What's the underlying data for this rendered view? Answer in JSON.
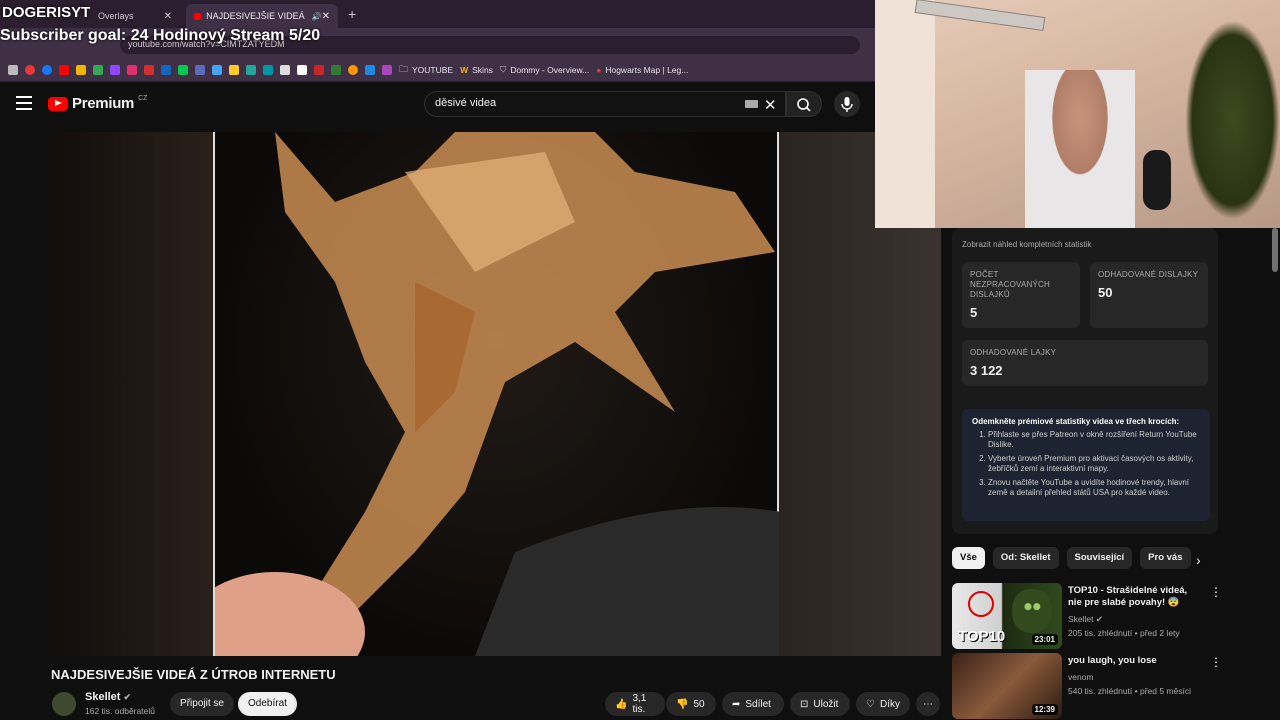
{
  "browser": {
    "tabs": [
      {
        "label": "Overlays"
      },
      {
        "label": "NAJDESIVEJŠIE VIDEÁ Z ÚTROB"
      }
    ],
    "url": "youtube.com/watch?v=CIMTZATYEDM",
    "bookmarks": [
      "YOUTUBE",
      "Skins",
      "Dommy - Overview...",
      "Hogwarts Map | Leg..."
    ]
  },
  "overlay": {
    "title": "DOGERISYT",
    "subtitle": "Subscriber goal: 24 Hodinový Stream 5/20"
  },
  "youtube": {
    "logo_text": "Premium",
    "logo_region": "CZ",
    "search_value": "děsivé videa"
  },
  "video": {
    "title": "NAJDESIVEJŠIE VIDEÁ Z ÚTROB INTERNETU",
    "channel": "Skellet",
    "subscribers": "162 tis. odběratelů",
    "join_label": "Připojit se",
    "subscribe_label": "Odebírat",
    "likes": "3,1 tis.",
    "dislikes": "50",
    "share_label": "Sdílet",
    "save_label": "Uložit",
    "thanks_label": "Díky"
  },
  "stats_panel": {
    "preview_link": "Zobrazit náhled kompletních statistik",
    "cards": [
      {
        "label": "POČET NEZPRACOVANÝCH DISLAJKŮ",
        "value": "5"
      },
      {
        "label": "ODHADOVANÉ DISLAJKY",
        "value": "50"
      },
      {
        "label": "ODHADOVANÉ LAJKY",
        "value": "3 122"
      }
    ],
    "premium_heading": "Odemkněte prémiové statistiky videa ve třech krocích:",
    "steps": [
      "Přihlaste se přes Patreon v okně rozšíření Return YouTube Dislike.",
      "Vyberte úroveň Premium pro aktivaci časových os aktivity, žebříčků zemí a interaktivní mapy.",
      "Znovu načtěte YouTube a uvidíte hodinové trendy, hlavní země a detailní přehled států USA pro každé video."
    ]
  },
  "chips": [
    "Vše",
    "Od: Skellet",
    "Související",
    "Pro vás"
  ],
  "recommendations": [
    {
      "title": "TOP10 - Strašidelné videá, nie pre slabé povahy! 😨",
      "channel": "Skellet",
      "meta": "205 tis. zhlédnutí • před 2 lety",
      "duration": "23:01",
      "thumb_text": "TOP10"
    },
    {
      "title": "you laugh, you lose",
      "channel": "venom",
      "meta": "540 tis. zhlédnutí • před 5 měsíci",
      "duration": "12:39"
    }
  ]
}
